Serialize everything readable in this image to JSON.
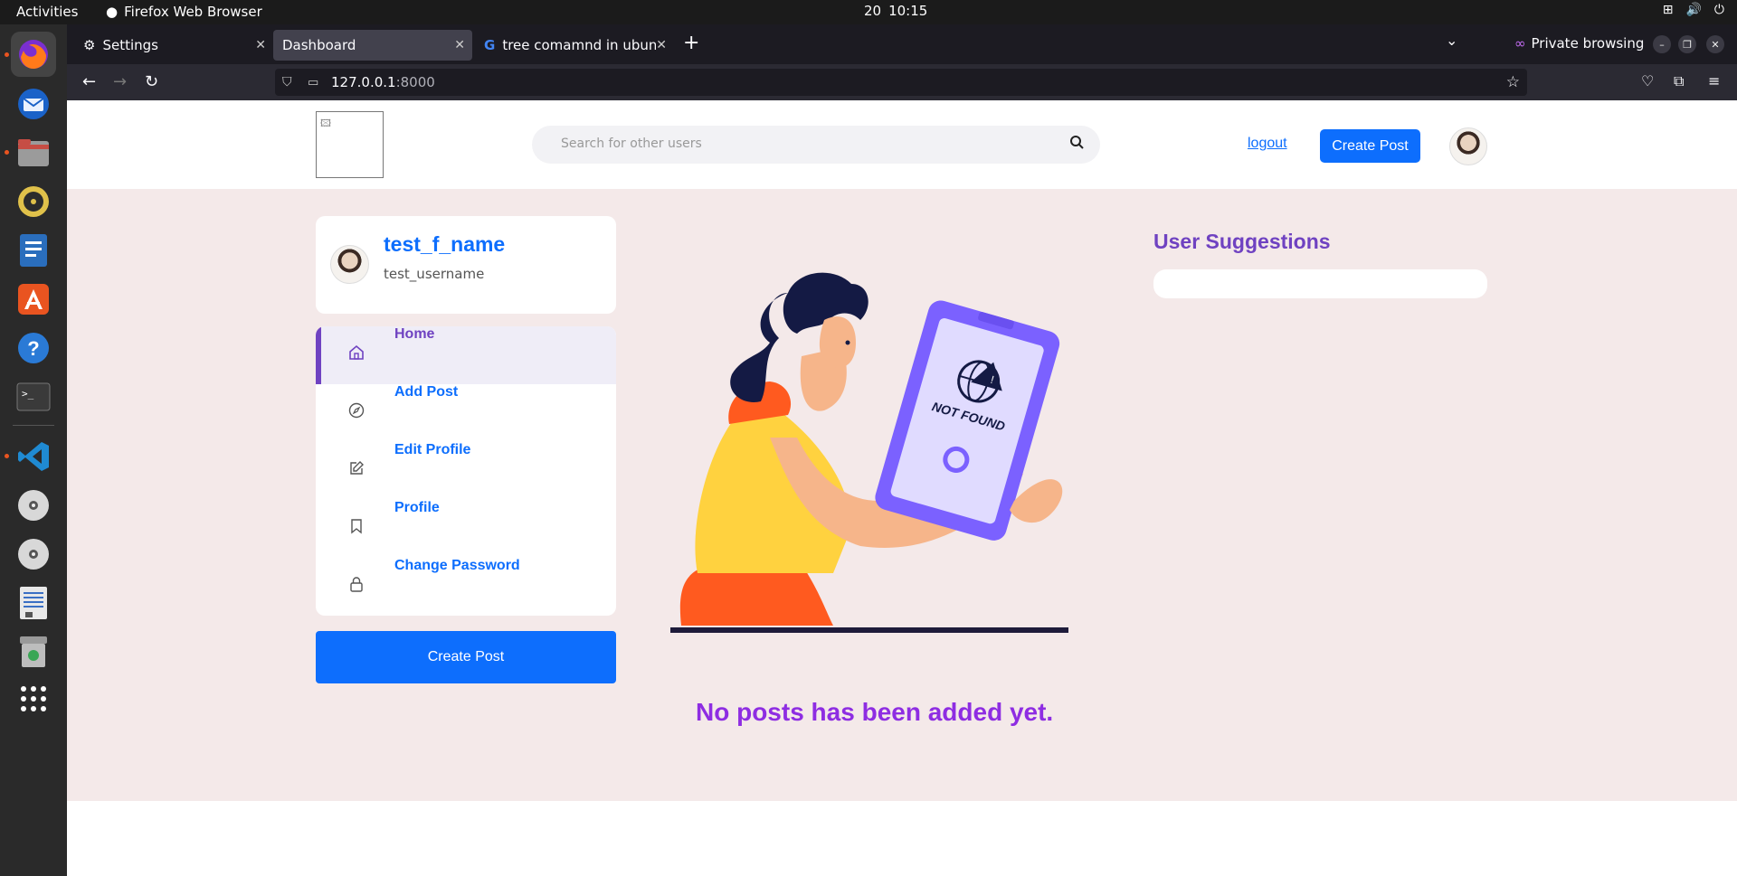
{
  "system": {
    "activities": "Activities",
    "app_name": "Firefox Web Browser",
    "clock_day": "20",
    "clock_time": "10:15"
  },
  "dock": {
    "items": [
      "firefox",
      "thunderbird",
      "files",
      "rhythmbox",
      "writer",
      "app-center",
      "help",
      "terminal",
      "vscode",
      "disc",
      "disc",
      "text-editor",
      "trash",
      "show-apps"
    ]
  },
  "browser": {
    "tabs": [
      {
        "label": "Settings",
        "icon": "gear-icon"
      },
      {
        "label": "Dashboard",
        "icon": ""
      },
      {
        "label": "tree comamnd in ubuntu",
        "icon": "google-icon"
      }
    ],
    "private_label": "Private browsing",
    "url_host": "127.0.0.1",
    "url_port": ":8000"
  },
  "header": {
    "search_placeholder": "Search for other users",
    "logout": "logout",
    "create_post": "Create Post"
  },
  "profile": {
    "name": "test_f_name",
    "username": "test_username"
  },
  "menu": {
    "items": [
      {
        "label": "Home",
        "icon": "home-icon"
      },
      {
        "label": "Add Post",
        "icon": "compass-icon"
      },
      {
        "label": "Edit Profile",
        "icon": "edit-icon"
      },
      {
        "label": "Profile",
        "icon": "bookmark-icon"
      },
      {
        "label": "Change Password",
        "icon": "lock-icon"
      }
    ]
  },
  "sidebar": {
    "create_post": "Create Post"
  },
  "main": {
    "illustration_text": "NOT FOUND",
    "empty_message": "No posts has been added yet."
  },
  "suggestions": {
    "title": "User Suggestions"
  },
  "colors": {
    "primary": "#0d6efd",
    "purple": "#6f42c1",
    "empty_text": "#8e2de2",
    "content_bg": "#f4e9e9"
  }
}
